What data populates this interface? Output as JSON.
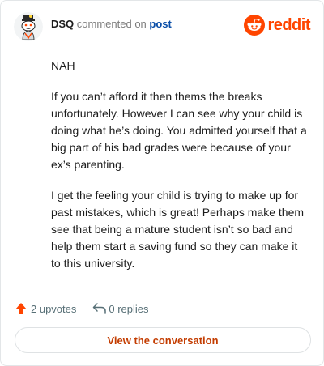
{
  "header": {
    "username": "DSQ",
    "action_text": "commented on",
    "post_link": "post",
    "brand_name": "reddit",
    "brand_color": "#ff4500",
    "avatar_icon": "snoo-avatar-icon",
    "brand_icon": "reddit-logo-icon"
  },
  "comment": {
    "paragraphs": [
      "NAH",
      "If you can’t afford it then thems the breaks unfortunately. However I can see why your child is doing what he’s doing. You admitted yourself that a big part of his bad grades were because of your ex’s parenting.",
      "I get the feeling your child is trying to make up for past mistakes, which is great! Perhaps make them see that being a mature student isn’t so bad and help them start a saving fund so they can make it to this university."
    ]
  },
  "actions": {
    "upvotes": "2 upvotes",
    "replies": "0 replies",
    "upvote_icon": "upvote-arrow-icon",
    "reply_icon": "reply-arrow-icon"
  },
  "cta": {
    "label": "View the conversation"
  }
}
